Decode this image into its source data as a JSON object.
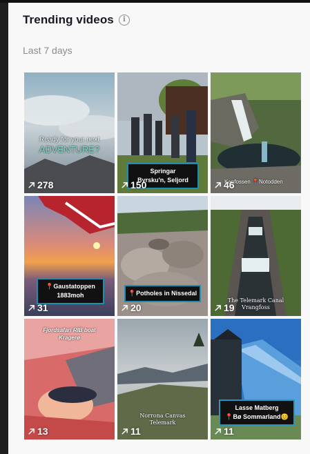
{
  "header": {
    "title": "Trending videos",
    "info_glyph": "i",
    "subtitle": "Last 7 days"
  },
  "colors": {
    "panel_bg": "#f8f8f8",
    "title": "#161823",
    "muted": "#8a8b91",
    "caption_border": "#1d8fb3"
  },
  "videos": [
    {
      "views": "278",
      "overlay_line1": "Ready for your next",
      "overlay_line2": "ADVENTURE?"
    },
    {
      "views": "150",
      "caption_line1": "Springar",
      "caption_line2": "Byrsku'n, Seljord"
    },
    {
      "views": "46",
      "overlay_line1": "Kanfossen 📍Notodden"
    },
    {
      "views": "31",
      "caption_line1": "📍Gaustatoppen",
      "caption_line2": "1883moh"
    },
    {
      "views": "20",
      "caption_line1": "📍Potholes in Nissedal"
    },
    {
      "views": "19",
      "overlay_line1": "The Telemark Canal",
      "overlay_line2": "Vrangfoss"
    },
    {
      "views": "13",
      "overlay_line1": "Fjordsafari RIB boat",
      "overlay_line2": "Kragerø"
    },
    {
      "views": "11",
      "overlay_line1": "Norrona Canvas",
      "overlay_line2": "Telemark"
    },
    {
      "views": "11",
      "caption_line1": "Lasse Matberg",
      "caption_line2": "📍Bø Sommarland😊"
    }
  ]
}
